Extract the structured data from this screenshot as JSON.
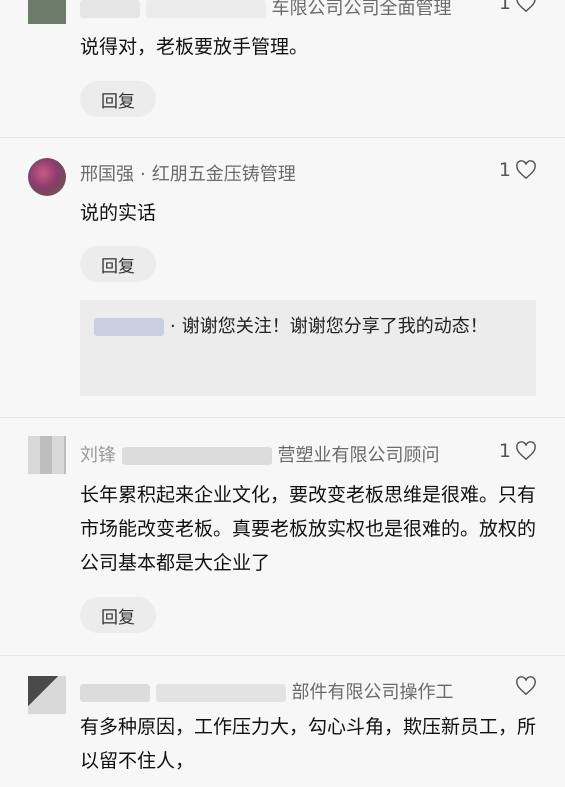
{
  "comments": [
    {
      "author_visible": "车限公司公司全面管理",
      "likes": "1",
      "text": "说得对，老板要放手管理。",
      "reply_label": "回复"
    },
    {
      "author": "邢国强",
      "company": "红朋五金压铸管理",
      "separator": "·",
      "likes": "1",
      "text": "说的实话",
      "reply_label": "回复",
      "sub_reply": {
        "separator": "·",
        "text": "谢谢您关注！谢谢您分享了我的动态！"
      }
    },
    {
      "author_visible": "刘锋",
      "company_visible": "营塑业有限公司顾问",
      "likes": "1",
      "text": "长年累积起来企业文化，要改变老板思维是很难。只有市场能改变老板。真要老板放实权也是很难的。放权的公司基本都是大企业了",
      "reply_label": "回复"
    },
    {
      "company_visible": "部件有限公司操作工",
      "likes": "",
      "text": "有多种原因，工作压力大，勾心斗角，欺压新员工，所以留不住人，"
    }
  ],
  "icons": {
    "like": "heart-outline-icon"
  }
}
